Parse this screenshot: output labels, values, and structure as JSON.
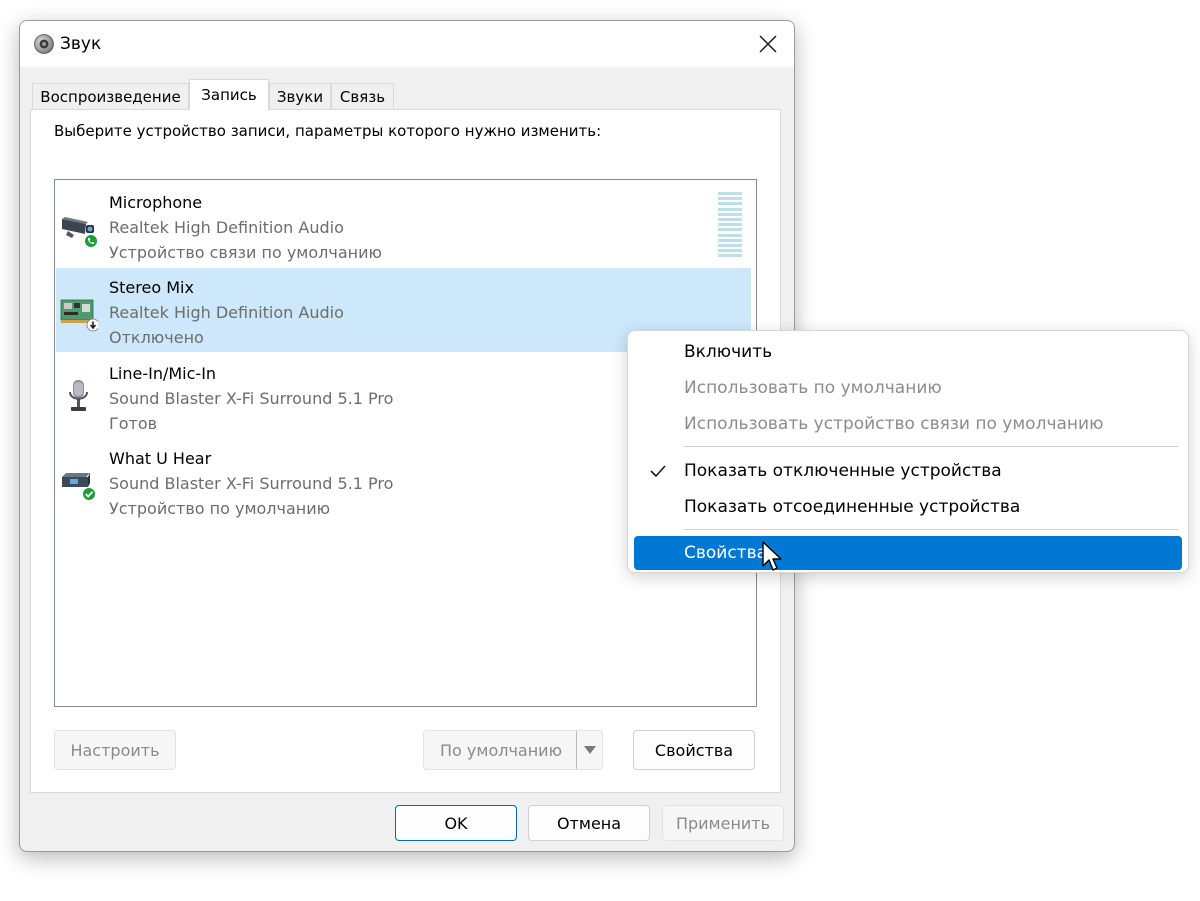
{
  "window": {
    "title": "Звук",
    "icon": "speaker-icon"
  },
  "tabs": [
    {
      "label": "Воспроизведение",
      "active": false
    },
    {
      "label": "Запись",
      "active": true
    },
    {
      "label": "Звуки",
      "active": false
    },
    {
      "label": "Связь",
      "active": false
    }
  ],
  "panel": {
    "instruction": "Выберите устройство записи, параметры которого нужно изменить:"
  },
  "devices": [
    {
      "name": "Microphone",
      "driver": "Realtek High Definition Audio",
      "status": "Устройство связи по умолчанию",
      "icon": "webcam-microphone-icon",
      "badge": "phone-badge-icon",
      "selected": false
    },
    {
      "name": "Stereo Mix",
      "driver": "Realtek High Definition Audio",
      "status": "Отключено",
      "icon": "sound-card-icon",
      "badge": "disabled-arrow-badge-icon",
      "selected": true
    },
    {
      "name": "Line-In/Mic-In",
      "driver": "Sound Blaster X-Fi Surround 5.1 Pro",
      "status": "Готов",
      "icon": "microphone-icon",
      "badge": "",
      "selected": false
    },
    {
      "name": "What U Hear",
      "driver": "Sound Blaster X-Fi Surround 5.1 Pro",
      "status": "Устройство по умолчанию",
      "icon": "audio-device-icon",
      "badge": "check-badge-icon",
      "selected": false
    }
  ],
  "buttons": {
    "configure": "Настроить",
    "set_default": "По умолчанию",
    "properties": "Свойства",
    "ok": "OK",
    "cancel": "Отмена",
    "apply": "Применить"
  },
  "context_menu": {
    "items": [
      {
        "label": "Включить",
        "enabled": true,
        "checked": false,
        "highlighted": false
      },
      {
        "label": "Использовать по умолчанию",
        "enabled": false,
        "checked": false,
        "highlighted": false
      },
      {
        "label": "Использовать устройство связи по умолчанию",
        "enabled": false,
        "checked": false,
        "highlighted": false
      },
      {
        "label": "Показать отключенные устройства",
        "enabled": true,
        "checked": true,
        "highlighted": false
      },
      {
        "label": "Показать отсоединенные устройства",
        "enabled": true,
        "checked": false,
        "highlighted": false
      },
      {
        "label": "Свойства",
        "enabled": true,
        "checked": false,
        "highlighted": true
      }
    ]
  },
  "colors": {
    "selection": "#cce8fa",
    "menu_highlight": "#0078d4",
    "level_meter": "#bcdfe8",
    "badge_green": "#1e9c3a"
  }
}
